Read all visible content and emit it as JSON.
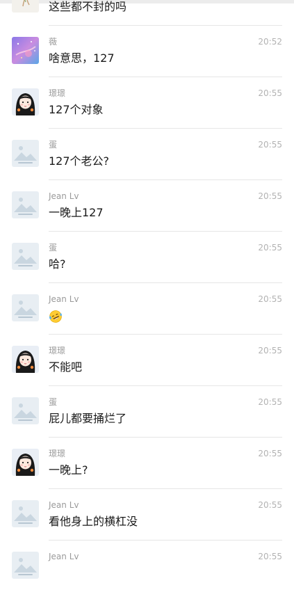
{
  "messages": [
    {
      "sender": "",
      "time": "",
      "text": "这些都不封的吗",
      "avatar": "weed-avatar",
      "emoji": ""
    },
    {
      "sender": "薇",
      "time": "20:52",
      "text": "啥意思，127",
      "avatar": "galaxy-avatar",
      "emoji": ""
    },
    {
      "sender": "璟璟",
      "time": "20:55",
      "text": "127个对象",
      "avatar": "girl-avatar",
      "emoji": ""
    },
    {
      "sender": "蛋",
      "time": "20:55",
      "text": "127个老公?",
      "avatar": "placeholder-avatar",
      "emoji": ""
    },
    {
      "sender": "Jean Lv",
      "time": "20:55",
      "text": "一晚上127",
      "avatar": "placeholder-avatar",
      "emoji": ""
    },
    {
      "sender": "蛋",
      "time": "20:55",
      "text": "哈?",
      "avatar": "placeholder-avatar",
      "emoji": ""
    },
    {
      "sender": "Jean Lv",
      "time": "20:55",
      "text": "",
      "avatar": "placeholder-avatar",
      "emoji": "crying-laughing-emoji"
    },
    {
      "sender": "璟璟",
      "time": "20:55",
      "text": "不能吧",
      "avatar": "girl-avatar",
      "emoji": ""
    },
    {
      "sender": "蛋",
      "time": "20:55",
      "text": "屁儿都要捅烂了",
      "avatar": "placeholder-avatar",
      "emoji": ""
    },
    {
      "sender": "璟璟",
      "time": "20:55",
      "text": "一晚上?",
      "avatar": "girl-avatar",
      "emoji": ""
    },
    {
      "sender": "Jean Lv",
      "time": "20:55",
      "text": "看他身上的横杠没",
      "avatar": "placeholder-avatar",
      "emoji": ""
    },
    {
      "sender": "Jean Lv",
      "time": "20:55",
      "text": "",
      "avatar": "placeholder-avatar",
      "emoji": ""
    }
  ],
  "colors": {
    "divider": "#e6e6e6",
    "name": "#9a9a9a",
    "time": "#b2b2b2",
    "text": "#1a1a1a",
    "placeholder_bg": "#e8eef3",
    "placeholder_shape": "#c9d6e0"
  }
}
